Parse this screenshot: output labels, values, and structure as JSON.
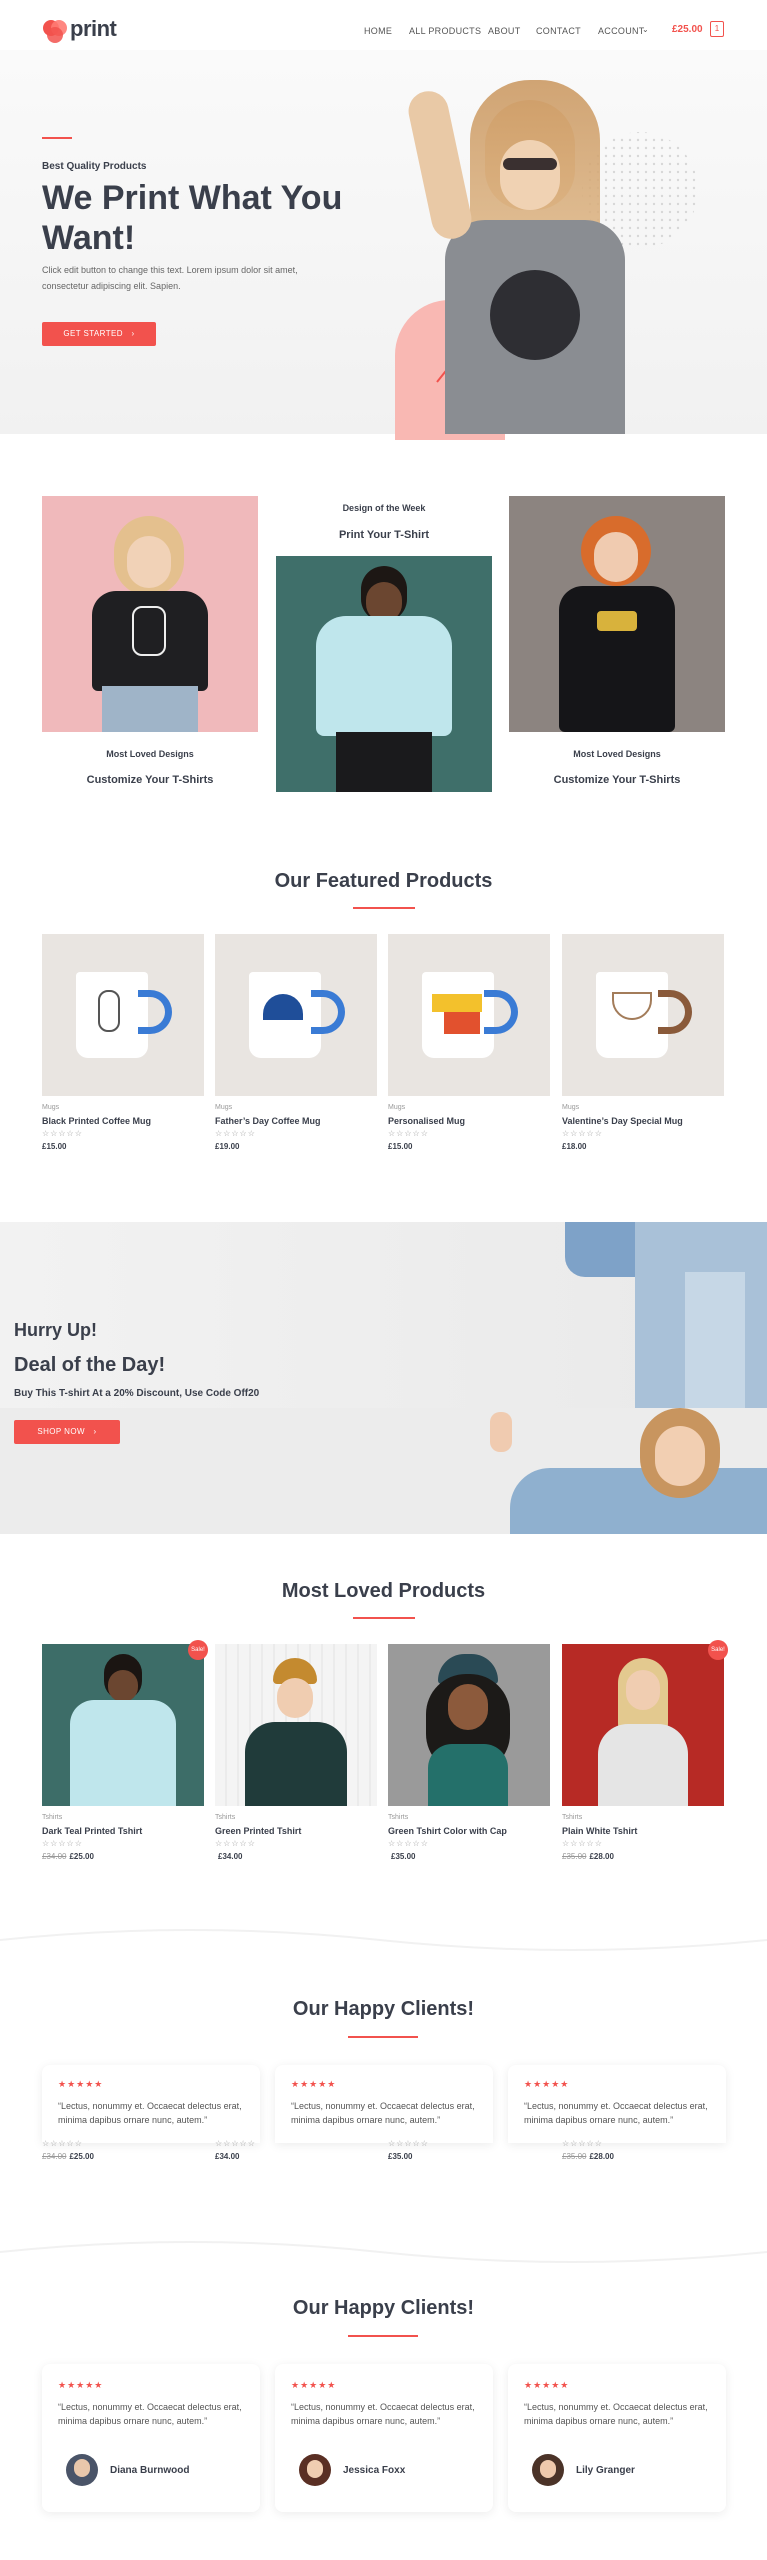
{
  "header": {
    "logo_text": "print",
    "nav": [
      "HOME",
      "ALL PRODUCTS",
      "ABOUT",
      "CONTACT",
      "ACCOUNT"
    ],
    "cart_total": "£25.00",
    "cart_count": "1"
  },
  "hero": {
    "kicker": "Best Quality Products",
    "title": "We Print What You Want!",
    "description": "Click edit button to change this text. Lorem ipsum dolor sit amet, consectetur adipiscing elit. Sapien.",
    "cta": "GET STARTED"
  },
  "designs": {
    "left_kicker": "Most Loved Designs",
    "left_title": "Customize Your T-Shirts",
    "center_kicker": "Design of the Week",
    "center_title": "Print Your T-Shirt",
    "right_kicker": "Most Loved Designs",
    "right_title": "Customize Your T-Shirts"
  },
  "featured": {
    "title": "Our Featured Products",
    "products": [
      {
        "category": "Mugs",
        "name": "Black Printed Coffee Mug",
        "price": "£15.00",
        "old_price": ""
      },
      {
        "category": "Mugs",
        "name": "Father’s Day Coffee Mug",
        "price": "£19.00",
        "old_price": ""
      },
      {
        "category": "Mugs",
        "name": "Personalised Mug",
        "price": "£15.00",
        "old_price": ""
      },
      {
        "category": "Mugs",
        "name": "Valentine’s Day Special Mug",
        "price": "£18.00",
        "old_price": ""
      }
    ]
  },
  "deal": {
    "kicker": "Hurry Up!",
    "title": "Deal of the Day!",
    "subtitle": "Buy This T-shirt At a 20% Discount, Use Code Off20",
    "cta": "SHOP NOW"
  },
  "loved": {
    "title": "Most Loved Products",
    "sale_label": "Sale!",
    "products": [
      {
        "category": "Tshirts",
        "name": "Dark Teal Printed Tshirt",
        "price": "£25.00",
        "old_price": "£34.00"
      },
      {
        "category": "Tshirts",
        "name": "Green Printed Tshirt",
        "price": "£34.00",
        "old_price": ""
      },
      {
        "category": "Tshirts",
        "name": "Green Tshirt Color with Cap",
        "price": "£35.00",
        "old_price": ""
      },
      {
        "category": "Tshirts",
        "name": "Plain White Tshirt",
        "price": "£28.00",
        "old_price": "£35.00"
      }
    ]
  },
  "clients_overlap": {
    "title": "Our Happy Clients!",
    "stars": "★★★★★",
    "product_stars": "☆☆☆☆☆",
    "reviews": [
      "“Lectus, nonummy et. Occaecat delectus erat, minima dapibus ornare nunc, autem.”",
      "“Lectus, nonummy et. Occaecat delectus erat, minima dapibus ornare nunc, autem.”",
      "“Lectus, nonummy et. Occaecat delectus erat, minima dapibus ornare nunc, autem.”"
    ],
    "prices": [
      {
        "old": "£34.00",
        "price": "£25.00"
      },
      {
        "old": "",
        "price": "£34.00"
      },
      {
        "old": "",
        "price": "£35.00"
      },
      {
        "old": "£35.00",
        "price": "£28.00"
      }
    ]
  },
  "clients": {
    "title": "Our Happy Clients!",
    "stars": "★★★★★",
    "reviews": [
      {
        "text": "“Lectus, nonummy et. Occaecat delectus erat, minima dapibus ornare nunc, autem.”",
        "name": "Diana Burnwood"
      },
      {
        "text": "“Lectus, nonummy et. Occaecat delectus erat, minima dapibus ornare nunc, autem.”",
        "name": "Jessica Foxx"
      },
      {
        "text": "“Lectus, nonummy et. Occaecat delectus erat, minima dapibus ornare nunc, autem.”",
        "name": "Lily Granger"
      }
    ]
  },
  "colors": {
    "accent": "#f2524d",
    "heading": "#3a3f4b"
  }
}
